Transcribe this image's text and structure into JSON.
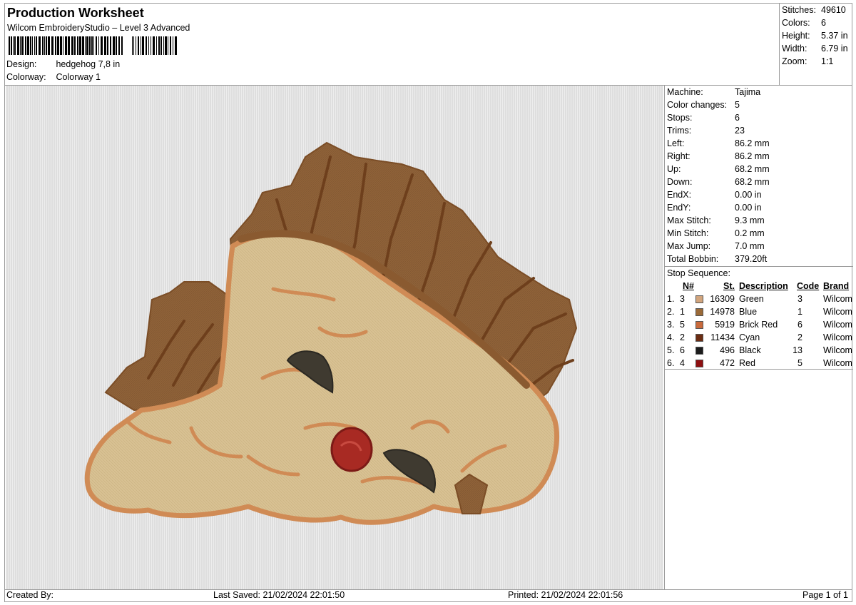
{
  "header": {
    "title": "Production Worksheet",
    "subtitle": "Wilcom EmbroideryStudio – Level 3 Advanced",
    "design_label": "Design:",
    "design_value": "hedgehog 7,8 in",
    "colorway_label": "Colorway:",
    "colorway_value": "Colorway 1"
  },
  "summary": [
    {
      "label": "Stitches:",
      "value": "49610"
    },
    {
      "label": "Colors:",
      "value": "6"
    },
    {
      "label": "Height:",
      "value": "5.37 in"
    },
    {
      "label": "Width:",
      "value": "6.79 in"
    },
    {
      "label": "Zoom:",
      "value": "1:1"
    }
  ],
  "machine_info": [
    {
      "label": "Machine:",
      "value": "Tajima"
    },
    {
      "label": "Color changes:",
      "value": "5"
    },
    {
      "label": "Stops:",
      "value": "6"
    },
    {
      "label": "Trims:",
      "value": "23"
    },
    {
      "label": "Left:",
      "value": "86.2 mm"
    },
    {
      "label": "Right:",
      "value": "86.2 mm"
    },
    {
      "label": "Up:",
      "value": "68.2 mm"
    },
    {
      "label": "Down:",
      "value": "68.2 mm"
    },
    {
      "label": "EndX:",
      "value": "0.00 in"
    },
    {
      "label": "EndY:",
      "value": "0.00 in"
    },
    {
      "label": "Max Stitch:",
      "value": "9.3 mm"
    },
    {
      "label": "Min Stitch:",
      "value": "0.2 mm"
    },
    {
      "label": "Max Jump:",
      "value": "7.0 mm"
    },
    {
      "label": "Total Bobbin:",
      "value": "379.20ft"
    }
  ],
  "stop_sequence": {
    "title": "Stop Sequence:",
    "headers": {
      "n": "N#",
      "st": "St.",
      "description": "Description",
      "code": "Code",
      "brand": "Brand"
    },
    "rows": [
      {
        "idx": "1.",
        "n": "3",
        "color": "#d2a57d",
        "st": "16309",
        "description": "Green",
        "code": "3",
        "brand": "Wilcom"
      },
      {
        "idx": "2.",
        "n": "1",
        "color": "#9b6a38",
        "st": "14978",
        "description": "Blue",
        "code": "1",
        "brand": "Wilcom"
      },
      {
        "idx": "3.",
        "n": "5",
        "color": "#c96a3c",
        "st": "5919",
        "description": "Brick Red",
        "code": "6",
        "brand": "Wilcom"
      },
      {
        "idx": "4.",
        "n": "2",
        "color": "#6b2c12",
        "st": "11434",
        "description": "Cyan",
        "code": "2",
        "brand": "Wilcom"
      },
      {
        "idx": "5.",
        "n": "6",
        "color": "#1c1c1c",
        "st": "496",
        "description": "Black",
        "code": "13",
        "brand": "Wilcom"
      },
      {
        "idx": "6.",
        "n": "4",
        "color": "#8e0f10",
        "st": "472",
        "description": "Red",
        "code": "5",
        "brand": "Wilcom"
      }
    ]
  },
  "footer": {
    "created_by": "Created By:",
    "last_saved": "Last Saved: 21/02/2024 22:01:50",
    "printed": "Printed: 21/02/2024 22:01:56",
    "page": "Page 1 of 1"
  },
  "colors": {
    "border": "#9a9a9a",
    "canvas_bg": "#e3e3e3",
    "spikes": "#8f6238",
    "spike_lines": "#6e3f1c",
    "face_fill": "#d8c193",
    "outline": "#d08b55",
    "eyelash": "#3f3a30",
    "nose": "#a82a23"
  }
}
